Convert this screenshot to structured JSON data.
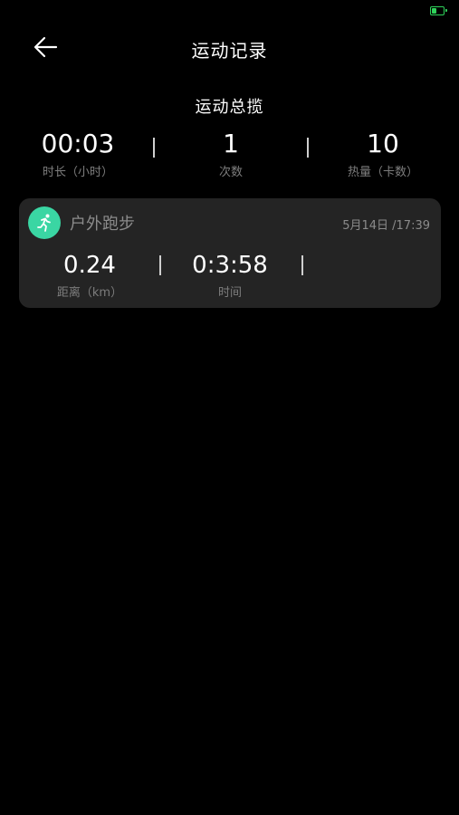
{
  "header": {
    "title": "运动记录"
  },
  "summary": {
    "title": "运动总揽",
    "stats": [
      {
        "value": "00:03",
        "label": "时长（小时）"
      },
      {
        "value": "1",
        "label": "次数"
      },
      {
        "value": "10",
        "label": "热量（卡数）"
      }
    ]
  },
  "records": [
    {
      "sport": "户外跑步",
      "date": "5月14日 /17:39",
      "stats": [
        {
          "value": "0.24",
          "label": "距离（km）"
        },
        {
          "value": "0:3:58",
          "label": "时间"
        }
      ]
    }
  ],
  "icons": {
    "back": "back-arrow-icon",
    "sport": "running-person-icon",
    "battery": "battery-charging-icon"
  },
  "colors": {
    "background": "#000000",
    "card": "#242424",
    "accent": "#3ad6a3",
    "battery": "#2fd35a",
    "muted_text": "#7d7d7d"
  }
}
